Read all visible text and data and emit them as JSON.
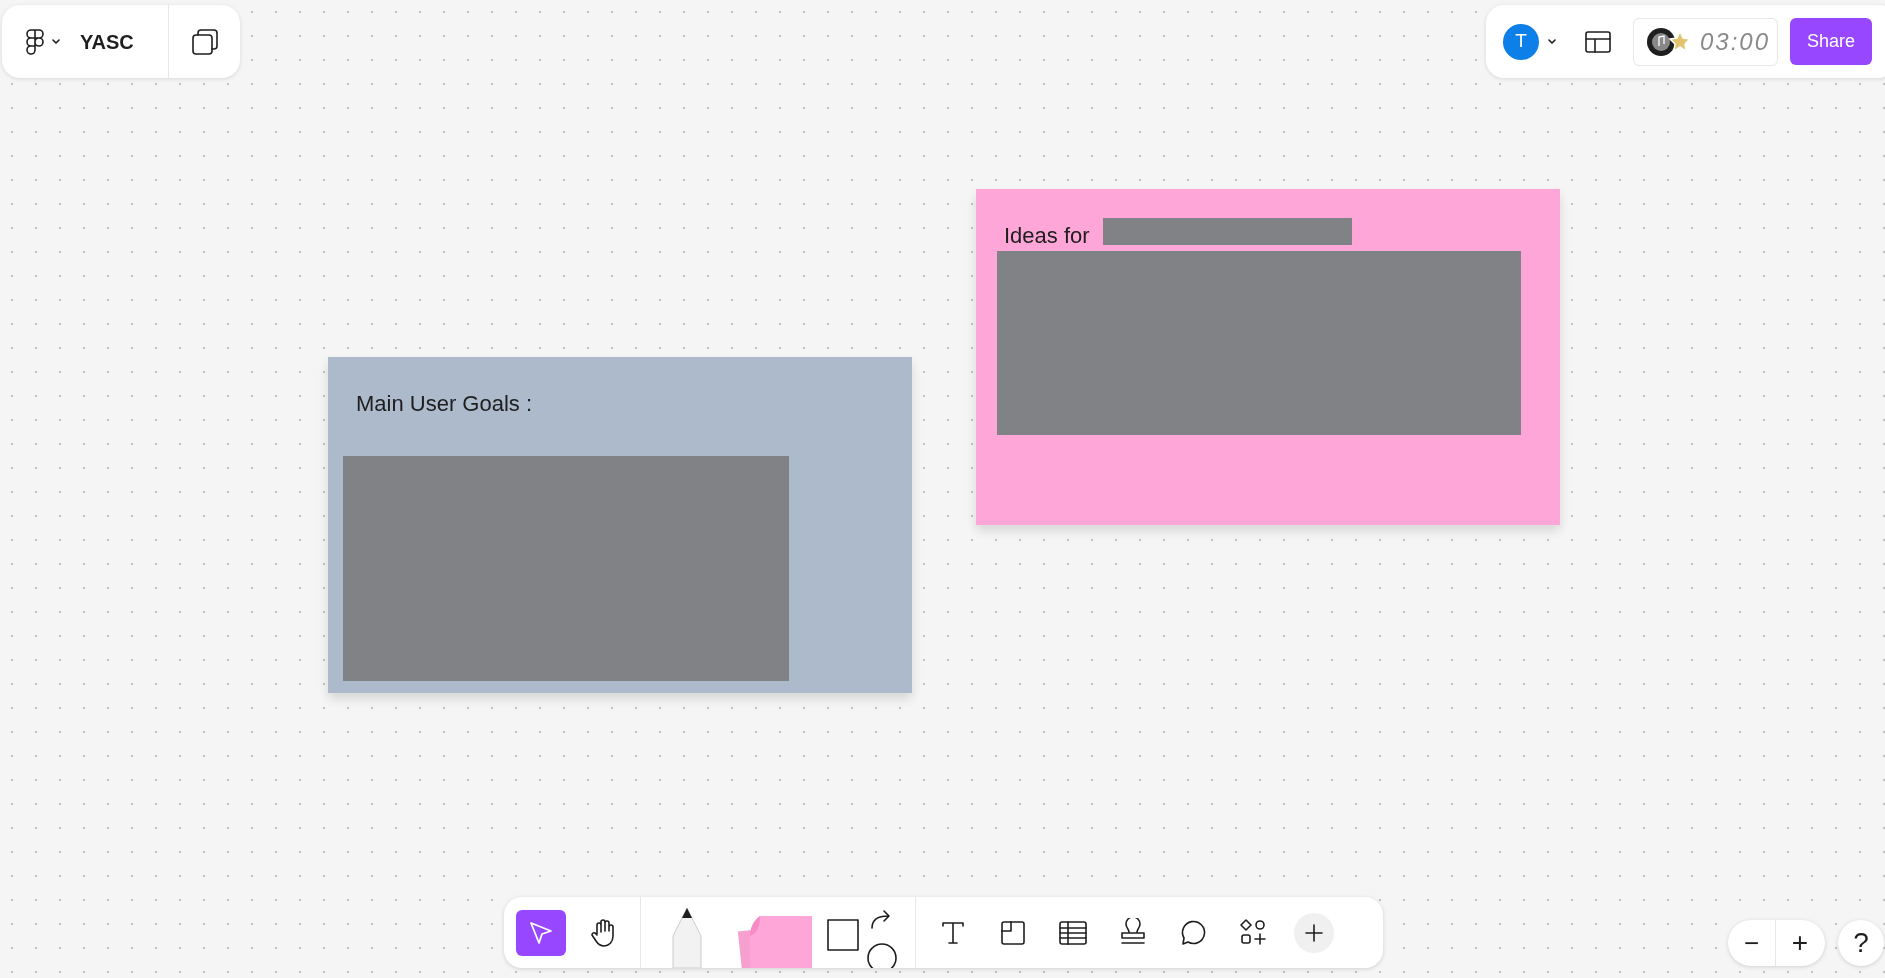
{
  "file_menu": {
    "title": "YASC"
  },
  "header": {
    "avatar": "T",
    "timer": "03:00",
    "share": "Share"
  },
  "notes": [
    {
      "kind": "blue",
      "title": "Main User Goals :"
    },
    {
      "kind": "pink",
      "title": "Ideas for"
    }
  ],
  "tools": [
    {
      "kind": "select",
      "selected": true
    },
    {
      "kind": "hand",
      "selected": false
    },
    {
      "kind": "pen",
      "selected": false
    },
    {
      "kind": "sticky",
      "selected": false
    },
    {
      "kind": "shapes",
      "selected": false
    },
    {
      "kind": "text",
      "selected": false
    },
    {
      "kind": "section",
      "selected": false
    },
    {
      "kind": "table",
      "selected": false
    },
    {
      "kind": "stamp",
      "selected": false
    },
    {
      "kind": "comment",
      "selected": false
    },
    {
      "kind": "widgets",
      "selected": false
    },
    {
      "kind": "more",
      "selected": false
    }
  ],
  "zoom": {
    "minus": "−",
    "plus": "+",
    "help": "?"
  }
}
